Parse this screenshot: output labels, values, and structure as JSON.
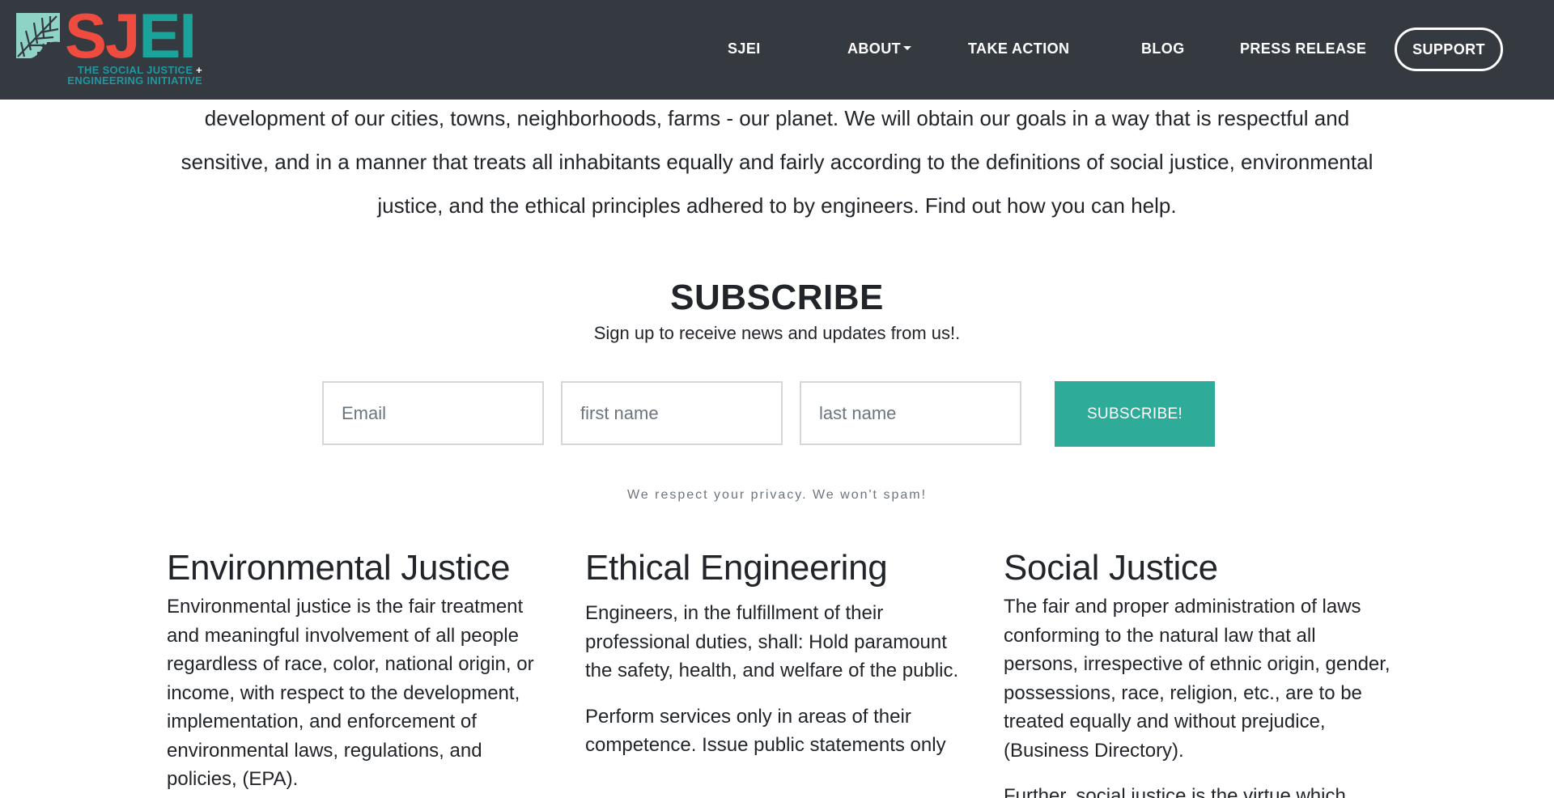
{
  "logo": {
    "letters_sj": "SJ",
    "letters_ei": "EI",
    "tagline_line1": "THE SOCIAL JUSTICE",
    "tagline_plus": "+",
    "tagline_line2": "ENGINEERING INITIATIVE",
    "colors": {
      "red": "#ef4b3f",
      "teal": "#1aa39a",
      "leaf": "#8fd3c4"
    },
    "icon": "leaf-gear-icon"
  },
  "nav": {
    "items": [
      {
        "label": "SJEI"
      },
      {
        "label": "ABOUT",
        "has_dropdown": true
      },
      {
        "label": "TAKE ACTION"
      },
      {
        "label": "BLOG"
      },
      {
        "label": "PRESS RELEASE"
      }
    ],
    "support_label": "SUPPORT",
    "background": "#343a40"
  },
  "intro": {
    "text": "development of our cities, towns, neighborhoods, farms - our planet. We will obtain our goals in a way that is respectful and sensitive, and in a manner that treats all inhabitants equally and fairly according to the definitions of social justice, environmental justice, and the ethical principles adhered to by engineers. Find out how you can help."
  },
  "subscribe": {
    "title": "SUBSCRIBE",
    "subtitle": "Sign up to receive news and updates from us!.",
    "email_placeholder": "Email",
    "first_name_placeholder": "first name",
    "last_name_placeholder": "last name",
    "button_label": "SUBSCRIBE!",
    "button_color": "#2fab99",
    "privacy_note": "We respect your privacy. We won't spam!"
  },
  "columns": [
    {
      "title": "Environmental Justice",
      "paragraphs": [
        "Environmental justice is the fair treatment and meaningful involvement of all people regardless of race, color, national origin, or income, with respect to the development, implementation, and enforcement of environmental laws, regulations, and policies, (EPA)."
      ]
    },
    {
      "title": "Ethical Engineering",
      "paragraphs": [
        "Engineers, in the fulfillment of their professional duties, shall: Hold paramount the safety, health, and welfare of the public.",
        "Perform services only in areas of their competence. Issue public statements only"
      ]
    },
    {
      "title": "Social Justice",
      "paragraphs": [
        "The fair and proper administration of laws conforming to the natural law that all persons, irrespective of ethnic origin, gender, possessions, race, religion, etc., are to be treated equally and without prejudice, (Business Directory).",
        "Further, social justice is the virtue which"
      ]
    }
  ]
}
